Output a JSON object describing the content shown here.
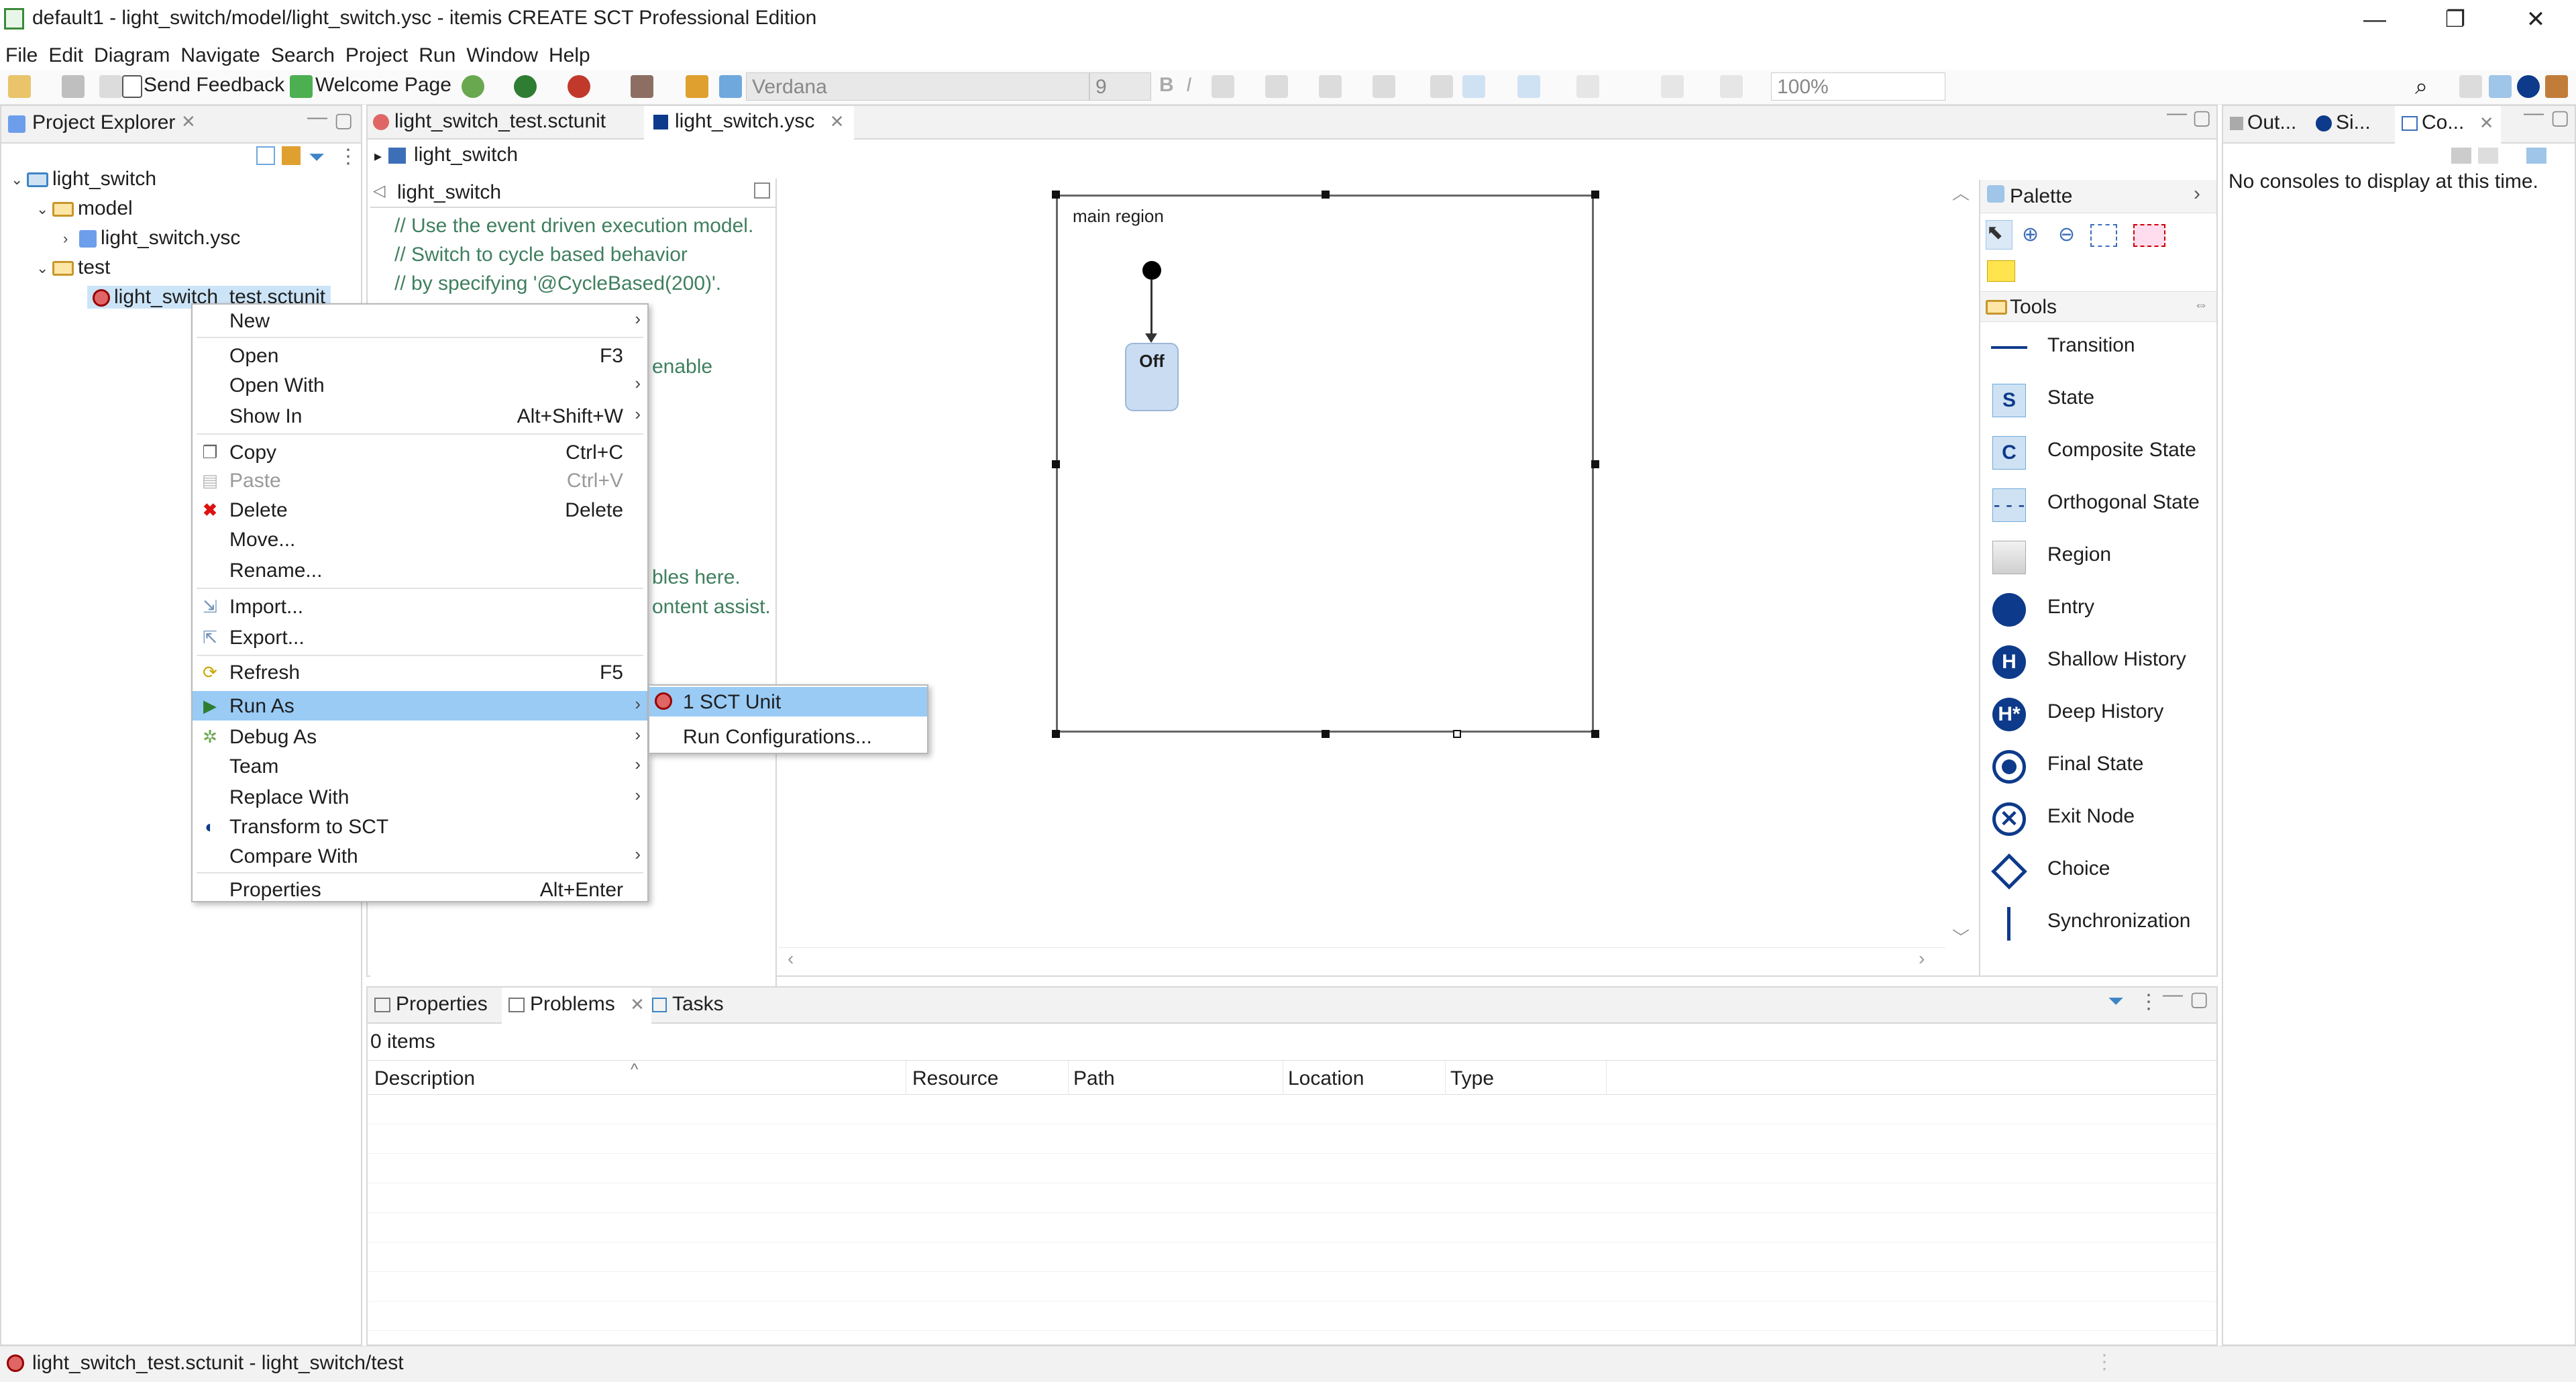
{
  "window": {
    "title": "default1 - light_switch/model/light_switch.ysc - itemis CREATE SCT Professional Edition",
    "minimize": "—",
    "restore": "❐",
    "close": "✕"
  },
  "menu": [
    "File",
    "Edit",
    "Diagram",
    "Navigate",
    "Search",
    "Project",
    "Run",
    "Window",
    "Help"
  ],
  "toolbar": {
    "send_feedback": "Send Feedback",
    "welcome_page": "Welcome Page",
    "font_name": "Verdana",
    "font_size": "9",
    "zoom": "100%"
  },
  "project_explorer": {
    "title": "Project Explorer",
    "items": [
      {
        "label": "light_switch"
      },
      {
        "label": "model"
      },
      {
        "label": "light_switch.ysc"
      },
      {
        "label": "test"
      },
      {
        "label": "light_switch_test.sctunit"
      }
    ]
  },
  "context_menu": {
    "items": [
      {
        "label": "New",
        "shortcut": ""
      },
      {
        "label": "Open",
        "shortcut": "F3"
      },
      {
        "label": "Open With",
        "shortcut": ""
      },
      {
        "label": "Show In",
        "shortcut": "Alt+Shift+W"
      },
      {
        "label": "Copy",
        "shortcut": "Ctrl+C"
      },
      {
        "label": "Paste",
        "shortcut": "Ctrl+V"
      },
      {
        "label": "Delete",
        "shortcut": "Delete"
      },
      {
        "label": "Move...",
        "shortcut": ""
      },
      {
        "label": "Rename...",
        "shortcut": ""
      },
      {
        "label": "Import...",
        "shortcut": ""
      },
      {
        "label": "Export...",
        "shortcut": ""
      },
      {
        "label": "Refresh",
        "shortcut": "F5"
      },
      {
        "label": "Run As",
        "shortcut": ""
      },
      {
        "label": "Debug As",
        "shortcut": ""
      },
      {
        "label": "Team",
        "shortcut": ""
      },
      {
        "label": "Replace With",
        "shortcut": ""
      },
      {
        "label": "Transform to SCT",
        "shortcut": ""
      },
      {
        "label": "Compare With",
        "shortcut": ""
      },
      {
        "label": "Properties",
        "shortcut": "Alt+Enter"
      }
    ],
    "submenu": [
      {
        "label": "1 SCT Unit"
      },
      {
        "label": "Run Configurations..."
      }
    ]
  },
  "editor": {
    "tabs": [
      {
        "label": "light_switch_test.sctunit"
      },
      {
        "label": "light_switch.ysc"
      }
    ],
    "breadcrumb": "light_switch",
    "definition_title": "light_switch",
    "code_lines": [
      "// Use the event driven execution model.",
      "// Switch to cycle based behavior",
      "// by specifying '@CycleBased(200)'.",
      "enable",
      "bles here.",
      "ontent assist."
    ],
    "region_label": "main region",
    "state_name": "Off"
  },
  "palette": {
    "title": "Palette",
    "tools_title": "Tools",
    "items": [
      {
        "label": "Transition"
      },
      {
        "label": "State"
      },
      {
        "label": "Composite State"
      },
      {
        "label": "Orthogonal State"
      },
      {
        "label": "Region"
      },
      {
        "label": "Entry"
      },
      {
        "label": "Shallow History"
      },
      {
        "label": "Deep History"
      },
      {
        "label": "Final State"
      },
      {
        "label": "Exit Node"
      },
      {
        "label": "Choice"
      },
      {
        "label": "Synchronization"
      }
    ]
  },
  "right_panel": {
    "tabs": [
      "Out...",
      "Si...",
      "Co..."
    ],
    "message": "No consoles to display at this time."
  },
  "bottom_panel": {
    "tabs": [
      "Properties",
      "Problems",
      "Tasks"
    ],
    "count": "0 items",
    "columns": [
      "Description",
      "Resource",
      "Path",
      "Location",
      "Type"
    ]
  },
  "status_bar": {
    "text": "light_switch_test.sctunit - light_switch/test"
  },
  "colors": {
    "selection": "#99cbf5",
    "state_fill": "#c9dcf2",
    "palette_blue": "#0d3a8a",
    "comment_green": "#3f7f5f"
  }
}
